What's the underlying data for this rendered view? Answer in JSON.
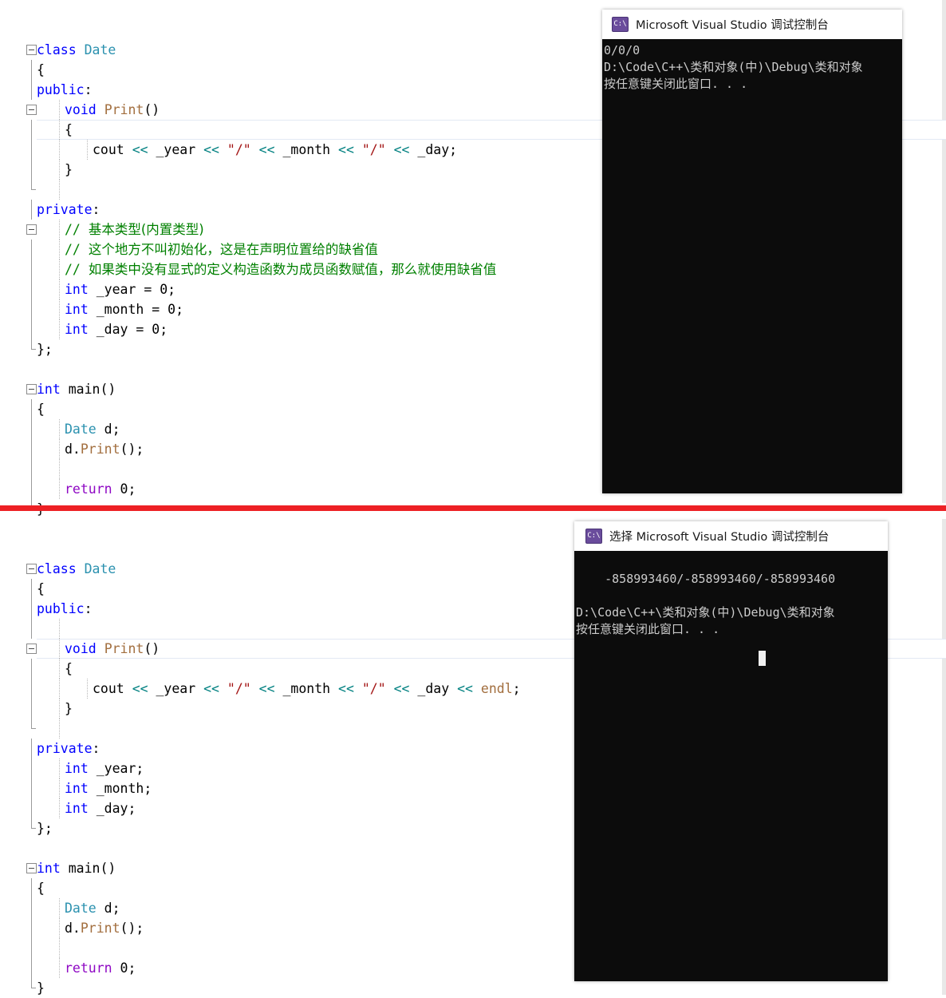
{
  "divider": {
    "color": "#ed2024"
  },
  "editor_top": {
    "name": "visual-studio-code-editor-before",
    "lines": [
      {
        "id": "t1",
        "fold": "box",
        "indent": 0,
        "tokens": [
          {
            "t": "class",
            "c": "kw"
          },
          {
            "t": " ",
            "c": "pln"
          },
          {
            "t": "Date",
            "c": "cls"
          }
        ]
      },
      {
        "id": "t2",
        "fold": "bar",
        "indent": 0,
        "tokens": [
          {
            "t": "{",
            "c": "pln"
          }
        ]
      },
      {
        "id": "t3",
        "fold": "bar",
        "indent": 0,
        "tokens": [
          {
            "t": "public",
            "c": "kw"
          },
          {
            "t": ":",
            "c": "pln"
          }
        ]
      },
      {
        "id": "t4",
        "fold": "box-g1",
        "indent": 1,
        "tokens": [
          {
            "t": "void",
            "c": "kw"
          },
          {
            "t": " ",
            "c": "pln"
          },
          {
            "t": "Print",
            "c": "fn"
          },
          {
            "t": "()",
            "c": "pln"
          }
        ]
      },
      {
        "id": "t5",
        "fold": "bar-g1",
        "indent": 1,
        "current": true,
        "tokens": [
          {
            "t": "{",
            "c": "pln"
          }
        ]
      },
      {
        "id": "t6",
        "fold": "bar-g1g2",
        "indent": 2,
        "tokens": [
          {
            "t": "cout",
            "c": "pln"
          },
          {
            "t": " ",
            "c": "pln"
          },
          {
            "t": "<<",
            "c": "op"
          },
          {
            "t": " _year ",
            "c": "pln"
          },
          {
            "t": "<<",
            "c": "op"
          },
          {
            "t": " ",
            "c": "pln"
          },
          {
            "t": "\"/\"",
            "c": "str"
          },
          {
            "t": " ",
            "c": "pln"
          },
          {
            "t": "<<",
            "c": "op"
          },
          {
            "t": " _month ",
            "c": "pln"
          },
          {
            "t": "<<",
            "c": "op"
          },
          {
            "t": " ",
            "c": "pln"
          },
          {
            "t": "\"/\"",
            "c": "str"
          },
          {
            "t": " ",
            "c": "pln"
          },
          {
            "t": "<<",
            "c": "op"
          },
          {
            "t": " _day;",
            "c": "pln"
          }
        ]
      },
      {
        "id": "t7",
        "fold": "bar-g1",
        "indent": 1,
        "tokens": [
          {
            "t": "}",
            "c": "pln"
          }
        ]
      },
      {
        "id": "t8",
        "fold": "barend-g1",
        "indent": 0,
        "tokens": []
      },
      {
        "id": "t9",
        "fold": "bar",
        "indent": 0,
        "tokens": [
          {
            "t": "private",
            "c": "kw"
          },
          {
            "t": ":",
            "c": "pln"
          }
        ]
      },
      {
        "id": "t10",
        "fold": "box-g1",
        "indent": 1,
        "tokens": [
          {
            "t": "// ",
            "c": "cmt"
          },
          {
            "t": "基本类型(内置类型)",
            "c": "cmt-cn"
          }
        ]
      },
      {
        "id": "t11",
        "fold": "bar-g1",
        "indent": 1,
        "tokens": [
          {
            "t": "// ",
            "c": "cmt"
          },
          {
            "t": "这个地方不叫初始化，这是在声明位置给的缺省值",
            "c": "cmt-cn"
          }
        ]
      },
      {
        "id": "t12",
        "fold": "bar-g1",
        "indent": 1,
        "tokens": [
          {
            "t": "// ",
            "c": "cmt"
          },
          {
            "t": "如果类中没有显式的定义构造函数为成员函数赋值，那么就使用缺省值",
            "c": "cmt-cn"
          }
        ]
      },
      {
        "id": "t13",
        "fold": "bar-g1",
        "indent": 1,
        "tokens": [
          {
            "t": "int",
            "c": "kw"
          },
          {
            "t": " _year ",
            "c": "pln"
          },
          {
            "t": "=",
            "c": "pln"
          },
          {
            "t": " 0;",
            "c": "pln"
          }
        ]
      },
      {
        "id": "t14",
        "fold": "bar-g1",
        "indent": 1,
        "tokens": [
          {
            "t": "int",
            "c": "kw"
          },
          {
            "t": " _month ",
            "c": "pln"
          },
          {
            "t": "=",
            "c": "pln"
          },
          {
            "t": " 0;",
            "c": "pln"
          }
        ]
      },
      {
        "id": "t15",
        "fold": "bar-g1",
        "indent": 1,
        "tokens": [
          {
            "t": "int",
            "c": "kw"
          },
          {
            "t": " _day ",
            "c": "pln"
          },
          {
            "t": "=",
            "c": "pln"
          },
          {
            "t": " 0;",
            "c": "pln"
          }
        ]
      },
      {
        "id": "t16",
        "fold": "barend",
        "indent": 0,
        "tokens": [
          {
            "t": "};",
            "c": "pln"
          }
        ]
      },
      {
        "id": "t17",
        "fold": "none",
        "indent": 0,
        "tokens": []
      },
      {
        "id": "t18",
        "fold": "box",
        "indent": 0,
        "tokens": [
          {
            "t": "int",
            "c": "kw"
          },
          {
            "t": " ",
            "c": "pln"
          },
          {
            "t": "main",
            "c": "pln"
          },
          {
            "t": "()",
            "c": "pln"
          }
        ]
      },
      {
        "id": "t19",
        "fold": "bar",
        "indent": 0,
        "tokens": [
          {
            "t": "{",
            "c": "pln"
          }
        ]
      },
      {
        "id": "t20",
        "fold": "bar-g1",
        "indent": 1,
        "tokens": [
          {
            "t": "Date",
            "c": "cls"
          },
          {
            "t": " d;",
            "c": "pln"
          }
        ]
      },
      {
        "id": "t21",
        "fold": "bar-g1",
        "indent": 1,
        "tokens": [
          {
            "t": "d.",
            "c": "pln"
          },
          {
            "t": "Print",
            "c": "fn"
          },
          {
            "t": "();",
            "c": "pln"
          }
        ]
      },
      {
        "id": "t22",
        "fold": "bar-g1",
        "indent": 1,
        "tokens": []
      },
      {
        "id": "t23",
        "fold": "bar-g1",
        "indent": 1,
        "tokens": [
          {
            "t": "return",
            "c": "ctl"
          },
          {
            "t": " 0;",
            "c": "pln"
          }
        ]
      },
      {
        "id": "t24",
        "fold": "barend",
        "indent": 0,
        "tokens": [
          {
            "t": "}",
            "c": "pln"
          }
        ]
      }
    ]
  },
  "editor_bottom": {
    "name": "visual-studio-code-editor-after",
    "lines": [
      {
        "id": "b1",
        "fold": "box",
        "indent": 0,
        "tokens": [
          {
            "t": "class",
            "c": "kw"
          },
          {
            "t": " ",
            "c": "pln"
          },
          {
            "t": "Date",
            "c": "cls"
          }
        ]
      },
      {
        "id": "b2",
        "fold": "bar",
        "indent": 0,
        "tokens": [
          {
            "t": "{",
            "c": "pln"
          }
        ]
      },
      {
        "id": "b3",
        "fold": "bar",
        "indent": 0,
        "tokens": [
          {
            "t": "public",
            "c": "kw"
          },
          {
            "t": ":",
            "c": "pln"
          }
        ]
      },
      {
        "id": "b4",
        "fold": "bar-g1",
        "indent": 1,
        "tokens": []
      },
      {
        "id": "b5",
        "fold": "box-g1",
        "indent": 1,
        "current": true,
        "tokens": [
          {
            "t": "void",
            "c": "kw"
          },
          {
            "t": " ",
            "c": "pln"
          },
          {
            "t": "Print",
            "c": "fn"
          },
          {
            "t": "()",
            "c": "pln"
          }
        ]
      },
      {
        "id": "b6",
        "fold": "bar-g1",
        "indent": 1,
        "tokens": [
          {
            "t": "{",
            "c": "pln"
          }
        ]
      },
      {
        "id": "b7",
        "fold": "bar-g1g2",
        "indent": 2,
        "tokens": [
          {
            "t": "cout",
            "c": "pln"
          },
          {
            "t": " ",
            "c": "pln"
          },
          {
            "t": "<<",
            "c": "op"
          },
          {
            "t": " _year ",
            "c": "pln"
          },
          {
            "t": "<<",
            "c": "op"
          },
          {
            "t": " ",
            "c": "pln"
          },
          {
            "t": "\"/\"",
            "c": "str"
          },
          {
            "t": " ",
            "c": "pln"
          },
          {
            "t": "<<",
            "c": "op"
          },
          {
            "t": " _month ",
            "c": "pln"
          },
          {
            "t": "<<",
            "c": "op"
          },
          {
            "t": " ",
            "c": "pln"
          },
          {
            "t": "\"/\"",
            "c": "str"
          },
          {
            "t": " ",
            "c": "pln"
          },
          {
            "t": "<<",
            "c": "op"
          },
          {
            "t": " _day ",
            "c": "pln"
          },
          {
            "t": "<<",
            "c": "op"
          },
          {
            "t": " ",
            "c": "pln"
          },
          {
            "t": "endl",
            "c": "fn"
          },
          {
            "t": ";",
            "c": "pln"
          }
        ]
      },
      {
        "id": "b8",
        "fold": "bar-g1",
        "indent": 1,
        "tokens": [
          {
            "t": "}",
            "c": "pln"
          }
        ]
      },
      {
        "id": "b9",
        "fold": "barend-g1",
        "indent": 0,
        "tokens": []
      },
      {
        "id": "b10",
        "fold": "bar",
        "indent": 0,
        "tokens": [
          {
            "t": "private",
            "c": "kw"
          },
          {
            "t": ":",
            "c": "pln"
          }
        ]
      },
      {
        "id": "b11",
        "fold": "bar-g1",
        "indent": 1,
        "tokens": [
          {
            "t": "int",
            "c": "kw"
          },
          {
            "t": " _year;",
            "c": "pln"
          }
        ]
      },
      {
        "id": "b12",
        "fold": "bar-g1",
        "indent": 1,
        "tokens": [
          {
            "t": "int",
            "c": "kw"
          },
          {
            "t": " _month;",
            "c": "pln"
          }
        ]
      },
      {
        "id": "b13",
        "fold": "bar-g1",
        "indent": 1,
        "tokens": [
          {
            "t": "int",
            "c": "kw"
          },
          {
            "t": " _day;",
            "c": "pln"
          }
        ]
      },
      {
        "id": "b14",
        "fold": "barend",
        "indent": 0,
        "tokens": [
          {
            "t": "};",
            "c": "pln"
          }
        ]
      },
      {
        "id": "b15",
        "fold": "none",
        "indent": 0,
        "tokens": []
      },
      {
        "id": "b16",
        "fold": "box",
        "indent": 0,
        "tokens": [
          {
            "t": "int",
            "c": "kw"
          },
          {
            "t": " ",
            "c": "pln"
          },
          {
            "t": "main",
            "c": "pln"
          },
          {
            "t": "()",
            "c": "pln"
          }
        ]
      },
      {
        "id": "b17",
        "fold": "bar",
        "indent": 0,
        "tokens": [
          {
            "t": "{",
            "c": "pln"
          }
        ]
      },
      {
        "id": "b18",
        "fold": "bar-g1",
        "indent": 1,
        "tokens": [
          {
            "t": "Date",
            "c": "cls"
          },
          {
            "t": " d;",
            "c": "pln"
          }
        ]
      },
      {
        "id": "b19",
        "fold": "bar-g1",
        "indent": 1,
        "tokens": [
          {
            "t": "d.",
            "c": "pln"
          },
          {
            "t": "Print",
            "c": "fn"
          },
          {
            "t": "();",
            "c": "pln"
          }
        ]
      },
      {
        "id": "b20",
        "fold": "bar-g1",
        "indent": 1,
        "tokens": []
      },
      {
        "id": "b21",
        "fold": "bar-g1",
        "indent": 1,
        "tokens": [
          {
            "t": "return",
            "c": "ctl"
          },
          {
            "t": " 0;",
            "c": "pln"
          }
        ]
      },
      {
        "id": "b22",
        "fold": "barend",
        "indent": 0,
        "tokens": [
          {
            "t": "}",
            "c": "pln"
          }
        ]
      }
    ]
  },
  "console_top": {
    "icon": "console-icon",
    "title": "Microsoft Visual Studio 调试控制台",
    "output": "0/0/0\nD:\\Code\\C++\\类和对象(中)\\Debug\\类和对象\n按任意键关闭此窗口. . ."
  },
  "console_bottom": {
    "icon": "console-icon",
    "title": "选择 Microsoft Visual Studio 调试控制台",
    "output": "-858993460/-858993460/-858993460\n\nD:\\Code\\C++\\类和对象(中)\\Debug\\类和对象\n按任意键关闭此窗口. . .",
    "cursor": "block-cursor"
  }
}
